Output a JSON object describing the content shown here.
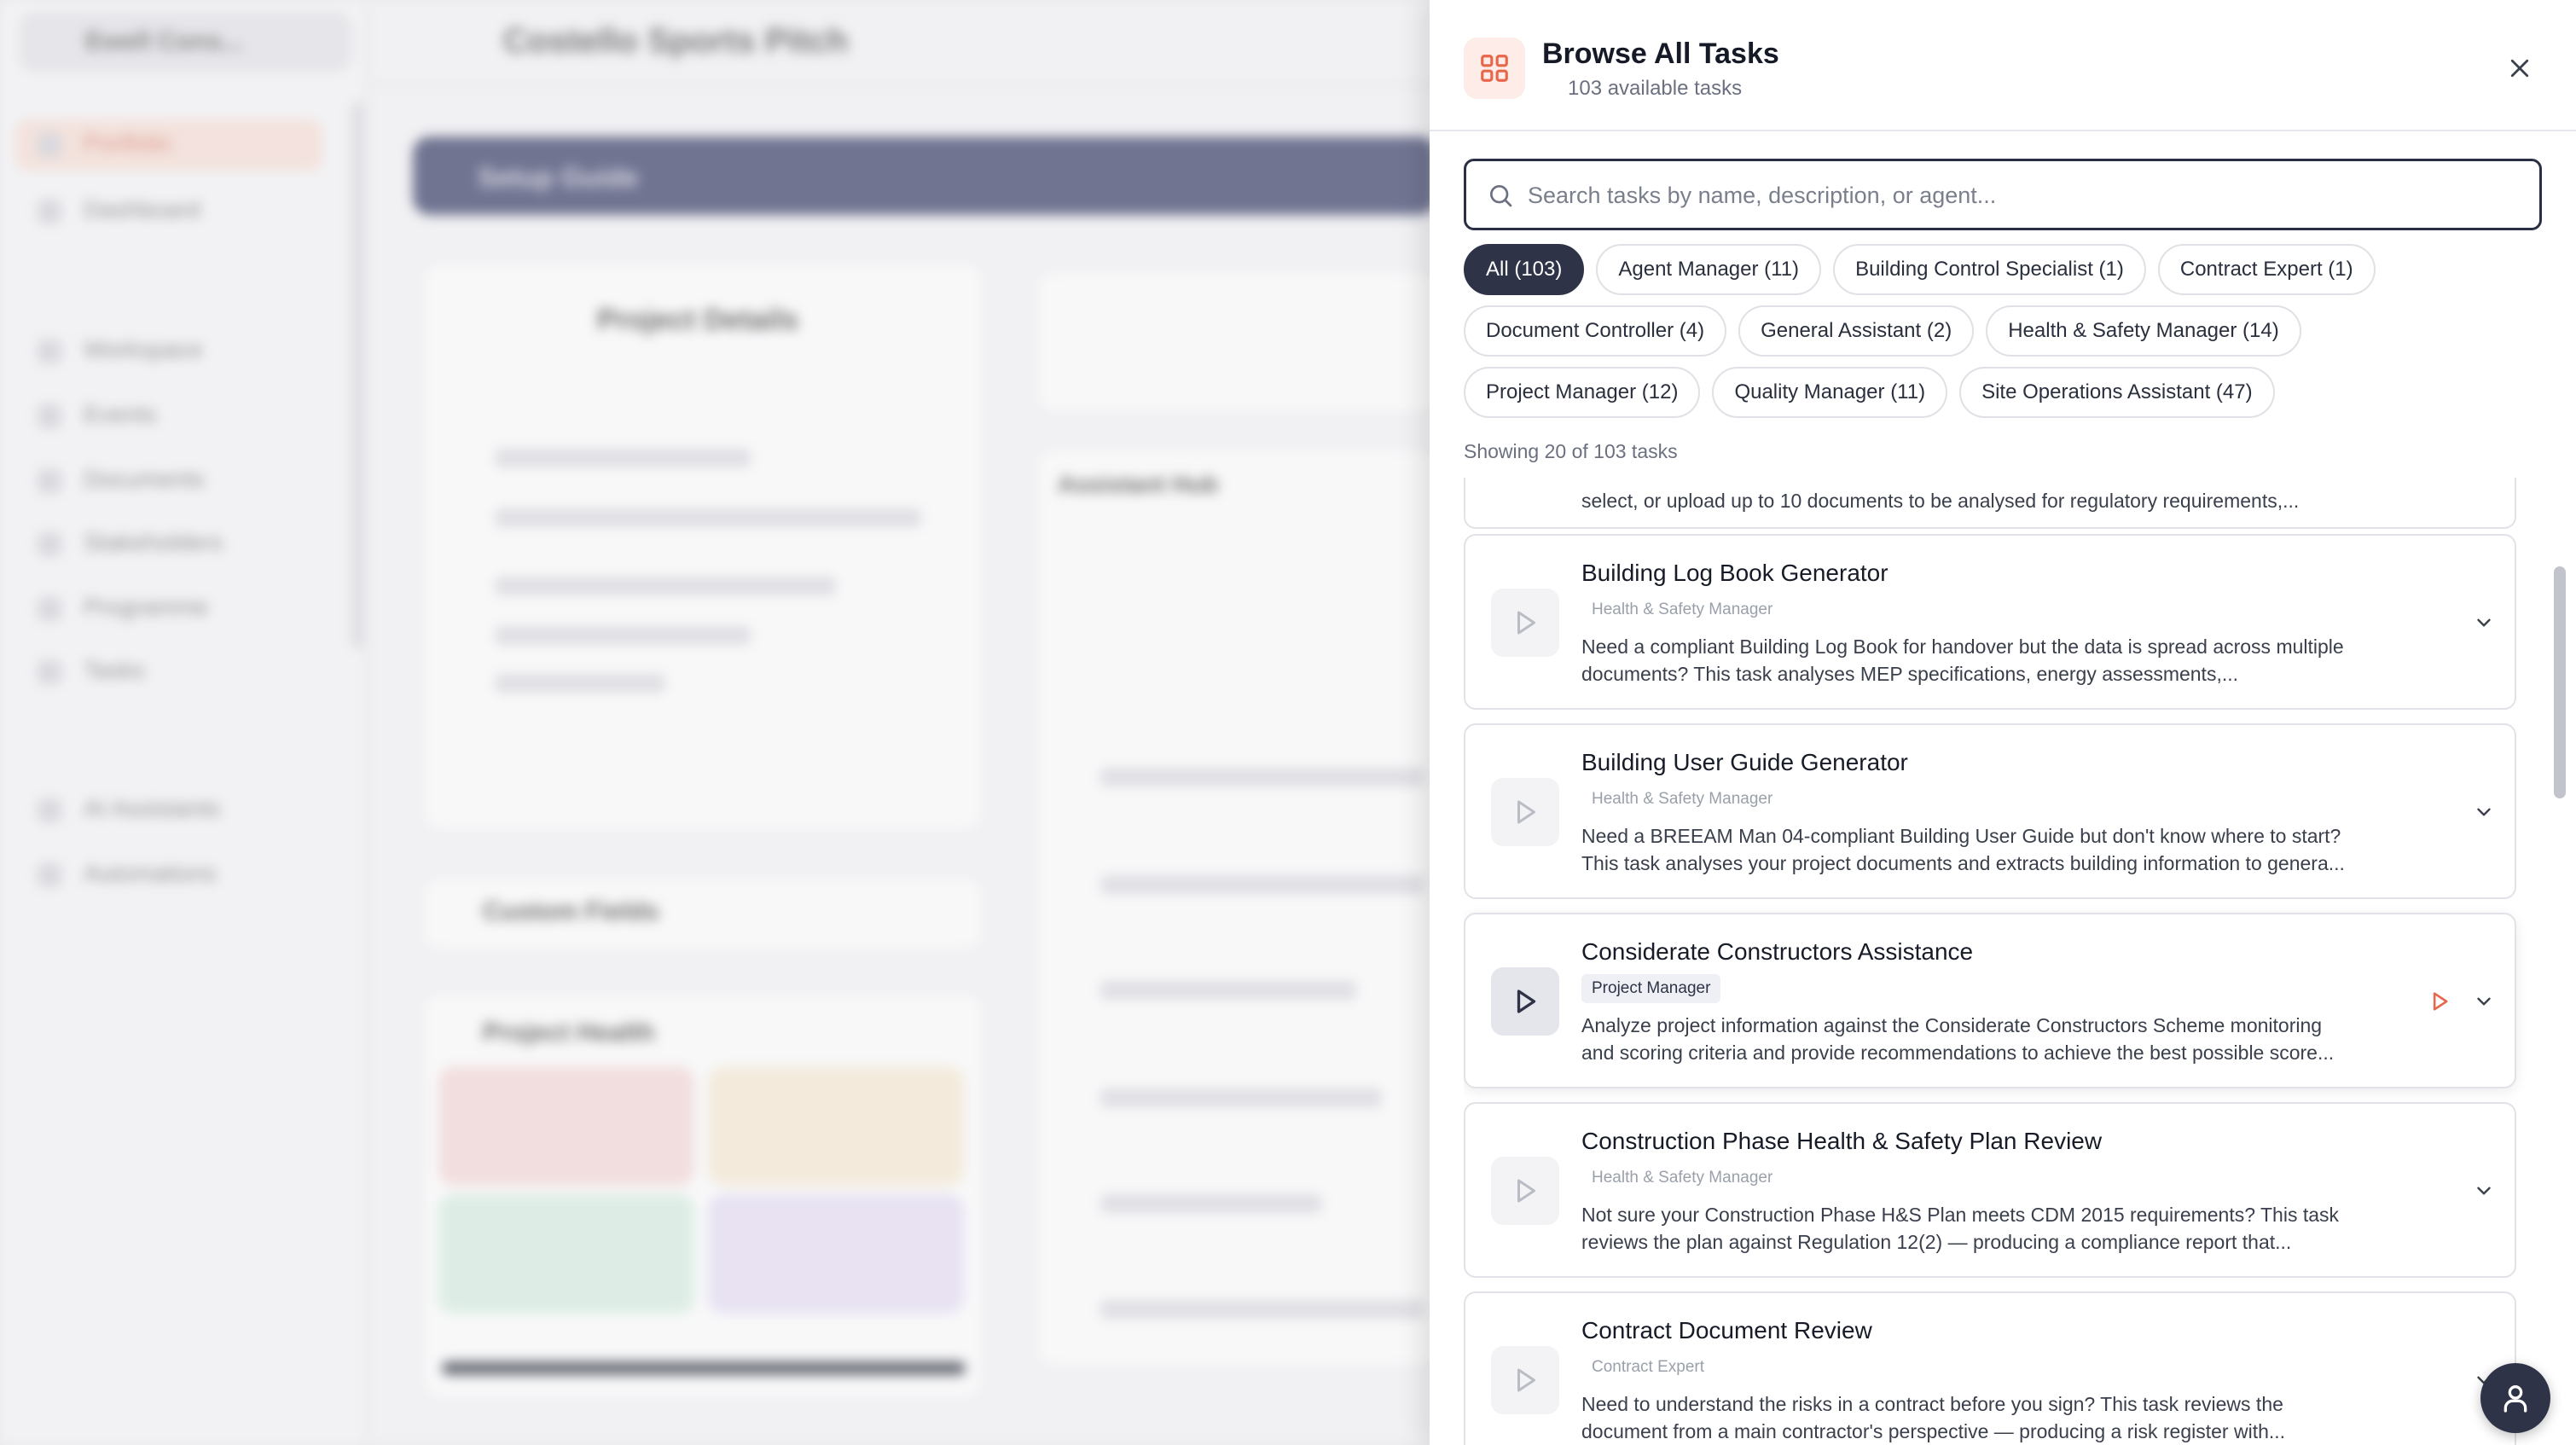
{
  "background": {
    "org_label": "Ewell Cons...",
    "project_title": "Costello Sports Pitch",
    "nav_items": [
      "Portfolio",
      "Dashboard",
      "Workspace",
      "Events",
      "Documents",
      "Stakeholders",
      "Programme",
      "Tasks",
      "AI Assistants",
      "Automations"
    ],
    "banner": "Setup Guide",
    "project_card_title": "Project Details",
    "custom_fields_title": "Custom Fields",
    "health_title": "Project Health",
    "assistant_hub_title": "Assistant Hub"
  },
  "drawer": {
    "title": "Browse All Tasks",
    "subtitle": "103 available tasks",
    "search_placeholder": "Search tasks by name, description, or agent...",
    "filters": [
      {
        "label": "All (103)",
        "active": true
      },
      {
        "label": "Agent Manager (11)",
        "active": false
      },
      {
        "label": "Building Control Specialist (1)",
        "active": false
      },
      {
        "label": "Contract Expert (1)",
        "active": false
      },
      {
        "label": "Document Controller (4)",
        "active": false
      },
      {
        "label": "General Assistant (2)",
        "active": false
      },
      {
        "label": "Health & Safety Manager (14)",
        "active": false
      },
      {
        "label": "Project Manager (12)",
        "active": false
      },
      {
        "label": "Quality Manager (11)",
        "active": false
      },
      {
        "label": "Site Operations Assistant (47)",
        "active": false
      }
    ],
    "showing": "Showing 20 of 103 tasks",
    "partial_desc": "select, or upload up to 10 documents to be analysed for regulatory requirements,...",
    "tasks": [
      {
        "title": "Building Log Book Generator",
        "agent": "Health & Safety Manager",
        "desc1": "Need a compliant Building Log Book for handover but the data is spread across multiple",
        "desc2": "documents? This task analyses MEP specifications, energy assessments,..."
      },
      {
        "title": "Building User Guide Generator",
        "agent": "Health & Safety Manager",
        "desc1": "Need a BREEAM Man 04-compliant Building User Guide but don't know where to start?",
        "desc2": "This task analyses your project documents and extracts building information to genera..."
      },
      {
        "title": "Considerate Constructors Assistance",
        "agent": "Project Manager",
        "desc1": "Analyze project information against the Considerate Constructors Scheme monitoring",
        "desc2": "and scoring criteria and provide recommendations to achieve the best possible score..."
      },
      {
        "title": "Construction Phase Health & Safety Plan Review",
        "agent": "Health & Safety Manager",
        "desc1": "Not sure your Construction Phase H&S Plan meets CDM 2015 requirements? This task",
        "desc2": "reviews the plan against Regulation 12(2) — producing a compliance report that..."
      },
      {
        "title": "Contract Document Review",
        "agent": "Contract Expert",
        "desc1": "Need to understand the risks in a contract before you sign? This task reviews the",
        "desc2": "document from a main contractor's perspective — producing a risk register with..."
      }
    ]
  },
  "colors": {
    "accent": "#e8664a",
    "dark": "#2e3347",
    "border": "#e1e2e7"
  }
}
